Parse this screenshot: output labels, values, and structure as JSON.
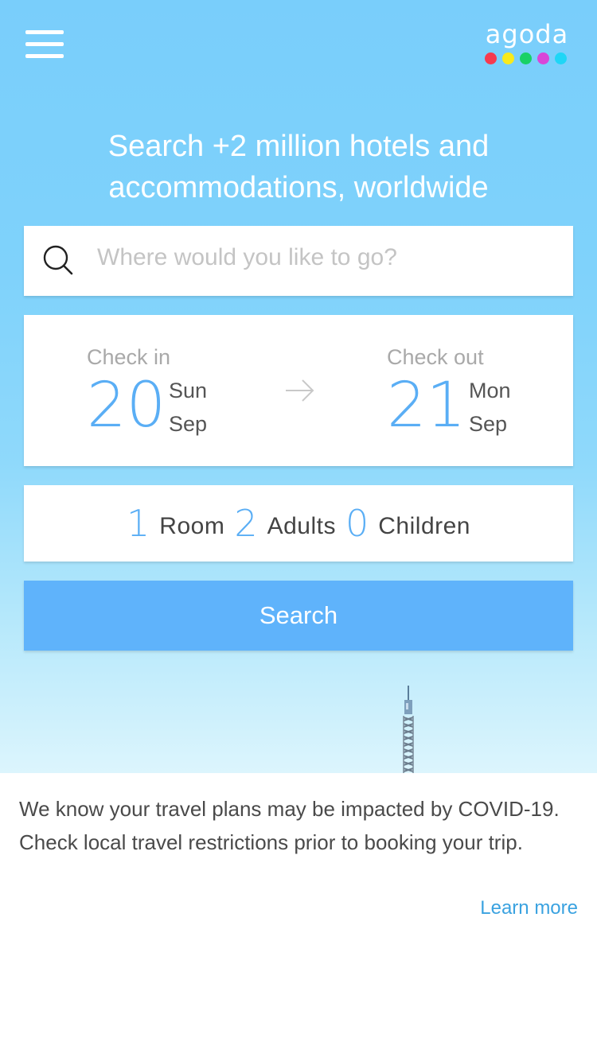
{
  "header": {
    "menu_icon": "hamburger-menu-icon",
    "logo": {
      "text": "agoda",
      "dot_colors": [
        "#f63a4f",
        "#f8ea1c",
        "#19d166",
        "#d946d8",
        "#1fd6f6"
      ]
    }
  },
  "hero": {
    "headline": "Search +2 million hotels and accommodations, worldwide"
  },
  "search": {
    "icon": "search-icon",
    "placeholder": "Where would you like to go?",
    "value": ""
  },
  "dates": {
    "check_in": {
      "label": "Check in",
      "day_number": "20",
      "weekday": "Sun",
      "month": "Sep"
    },
    "arrow_icon": "arrow-right-icon",
    "check_out": {
      "label": "Check out",
      "day_number": "21",
      "weekday": "Mon",
      "month": "Sep"
    }
  },
  "occupancy": {
    "rooms": {
      "count": "1",
      "label": "Room"
    },
    "adults": {
      "count": "2",
      "label": "Adults"
    },
    "children": {
      "count": "0",
      "label": "Children"
    }
  },
  "search_button": {
    "label": "Search"
  },
  "notice": {
    "text": "We know your travel plans may be impacted by COVID-19. Check local travel restrictions prior to booking your trip.",
    "link_label": "Learn more"
  },
  "colors": {
    "accent": "#5aaef5",
    "button": "#5fb3fb",
    "link": "#3aa2e0",
    "sky_top": "#79cefb"
  }
}
